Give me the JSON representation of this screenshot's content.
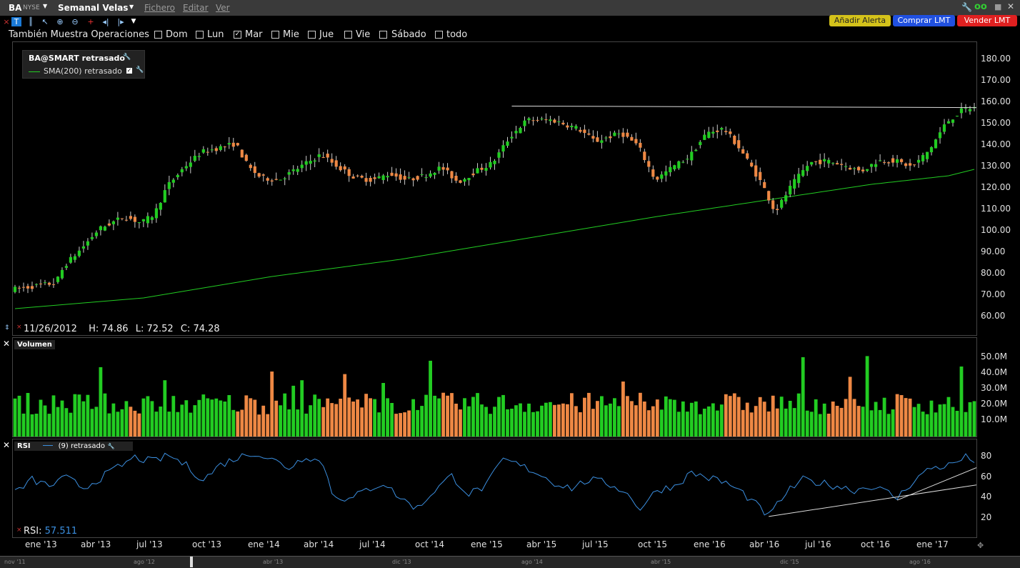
{
  "window": {
    "symbol": "BA",
    "exchange": "NYSE",
    "timeframe": "Semanal Velas",
    "menu": [
      "Fichero",
      "Editar",
      "Ver"
    ]
  },
  "buttons": {
    "alert": "Añadir Alerta",
    "buy": "Comprar LMT",
    "sell": "Vender LMT"
  },
  "options": {
    "label": "También Muestra Operaciones",
    "days": [
      {
        "label": "Dom",
        "checked": false
      },
      {
        "label": "Lun",
        "checked": false
      },
      {
        "label": "Mar",
        "checked": true
      },
      {
        "label": "Mie",
        "checked": false
      },
      {
        "label": "Jue",
        "checked": false
      },
      {
        "label": "Vie",
        "checked": false
      },
      {
        "label": "Sábado",
        "checked": false
      },
      {
        "label": "todo",
        "checked": false
      }
    ]
  },
  "price_panel": {
    "legend_title": "BA@SMART retrasado",
    "legend_sma": "SMA(200) retrasado",
    "info_date": "11/26/2012",
    "info_h": "H: 74.86",
    "info_l": "L: 72.52",
    "info_c": "C: 74.28",
    "y_ticks": [
      "180.00",
      "170.00",
      "160.00",
      "150.00",
      "140.00",
      "130.00",
      "120.00",
      "110.00",
      "100.00",
      "90.00",
      "80.00",
      "70.00",
      "60.00"
    ]
  },
  "volume_panel": {
    "title": "Volumen",
    "y_ticks": [
      "50.0M",
      "40.0M",
      "30.0M",
      "20.0M",
      "10.0M"
    ]
  },
  "rsi_panel": {
    "title": "RSI",
    "legend": "(9) retrasado",
    "readout_label": "RSI:",
    "readout_value": "57.511",
    "y_ticks": [
      "80",
      "60",
      "40",
      "20"
    ]
  },
  "x_ticks": [
    "ene '13",
    "abr '13",
    "jul '13",
    "oct '13",
    "ene '14",
    "abr '14",
    "jul '14",
    "oct '14",
    "ene '15",
    "abr '15",
    "jul '15",
    "oct '15",
    "ene '16",
    "abr '16",
    "jul '16",
    "oct '16",
    "ene '17"
  ],
  "overview_ticks": [
    "nov '11",
    "ago '12",
    "abr '13",
    "dic '13",
    "ago '14",
    "abr '15",
    "dic '15",
    "ago '16"
  ],
  "colors": {
    "up": "#22cc22",
    "down": "#ee8844",
    "sma": "#22cc22",
    "rsi": "#3b8fe0",
    "alert_btn": "#d4c21a",
    "buy_btn": "#2050e0",
    "sell_btn": "#e02020"
  },
  "chart_data": {
    "type": "candlestick",
    "weeks_shown": 225,
    "price_ylim": [
      55,
      185
    ],
    "price_knots": [
      [
        0,
        73
      ],
      [
        10,
        76
      ],
      [
        12,
        84
      ],
      [
        16,
        92
      ],
      [
        20,
        101
      ],
      [
        26,
        107
      ],
      [
        30,
        104
      ],
      [
        33,
        108
      ],
      [
        36,
        121
      ],
      [
        40,
        130
      ],
      [
        44,
        137
      ],
      [
        48,
        139
      ],
      [
        52,
        141
      ],
      [
        55,
        130
      ],
      [
        58,
        125
      ],
      [
        62,
        124
      ],
      [
        67,
        130
      ],
      [
        72,
        136
      ],
      [
        76,
        130
      ],
      [
        80,
        125
      ],
      [
        84,
        124
      ],
      [
        88,
        127
      ],
      [
        92,
        124
      ],
      [
        96,
        126
      ],
      [
        100,
        130
      ],
      [
        104,
        123
      ],
      [
        108,
        128
      ],
      [
        112,
        132
      ],
      [
        116,
        144
      ],
      [
        120,
        152
      ],
      [
        126,
        152
      ],
      [
        132,
        148
      ],
      [
        136,
        142
      ],
      [
        142,
        146
      ],
      [
        146,
        140
      ],
      [
        150,
        124
      ],
      [
        154,
        130
      ],
      [
        158,
        135
      ],
      [
        162,
        146
      ],
      [
        166,
        148
      ],
      [
        170,
        138
      ],
      [
        175,
        122
      ],
      [
        178,
        109
      ],
      [
        182,
        122
      ],
      [
        186,
        132
      ],
      [
        190,
        133
      ],
      [
        194,
        131
      ],
      [
        198,
        128
      ],
      [
        202,
        133
      ],
      [
        206,
        133
      ],
      [
        210,
        130
      ],
      [
        214,
        138
      ],
      [
        218,
        151
      ],
      [
        222,
        157
      ],
      [
        225,
        158
      ],
      [
        227,
        168
      ],
      [
        229,
        175
      ],
      [
        232,
        180
      ]
    ],
    "sma_points": [
      [
        0,
        64
      ],
      [
        30,
        69
      ],
      [
        60,
        79
      ],
      [
        90,
        87
      ],
      [
        120,
        97
      ],
      [
        150,
        107
      ],
      [
        180,
        116
      ],
      [
        200,
        122
      ],
      [
        218,
        126
      ],
      [
        232,
        133
      ]
    ],
    "volume_ylim": [
      0,
      60
    ],
    "rsi_ylim": [
      5,
      95
    ],
    "rsi_knots": [
      [
        0,
        45
      ],
      [
        4,
        58
      ],
      [
        8,
        52
      ],
      [
        12,
        60
      ],
      [
        16,
        50
      ],
      [
        20,
        60
      ],
      [
        24,
        70
      ],
      [
        28,
        80
      ],
      [
        32,
        76
      ],
      [
        36,
        82
      ],
      [
        40,
        72
      ],
      [
        44,
        58
      ],
      [
        48,
        73
      ],
      [
        52,
        80
      ],
      [
        56,
        85
      ],
      [
        60,
        78
      ],
      [
        64,
        70
      ],
      [
        68,
        82
      ],
      [
        72,
        74
      ],
      [
        74,
        45
      ],
      [
        78,
        38
      ],
      [
        82,
        48
      ],
      [
        86,
        55
      ],
      [
        90,
        40
      ],
      [
        94,
        30
      ],
      [
        98,
        48
      ],
      [
        102,
        62
      ],
      [
        106,
        44
      ],
      [
        110,
        52
      ],
      [
        114,
        78
      ],
      [
        118,
        72
      ],
      [
        122,
        65
      ],
      [
        126,
        55
      ],
      [
        130,
        50
      ],
      [
        134,
        58
      ],
      [
        138,
        55
      ],
      [
        142,
        48
      ],
      [
        146,
        30
      ],
      [
        150,
        48
      ],
      [
        154,
        52
      ],
      [
        158,
        65
      ],
      [
        162,
        60
      ],
      [
        166,
        55
      ],
      [
        170,
        45
      ],
      [
        174,
        30
      ],
      [
        176,
        22
      ],
      [
        180,
        45
      ],
      [
        184,
        58
      ],
      [
        188,
        55
      ],
      [
        192,
        52
      ],
      [
        196,
        48
      ],
      [
        200,
        52
      ],
      [
        204,
        45
      ],
      [
        206,
        40
      ],
      [
        210,
        58
      ],
      [
        214,
        70
      ],
      [
        218,
        72
      ],
      [
        222,
        80
      ],
      [
        226,
        75
      ],
      [
        230,
        80
      ]
    ],
    "resistance_line": [
      [
        116,
        158.5
      ],
      [
        232,
        157.8
      ]
    ],
    "rsi_trend1": [
      [
        176,
        22
      ],
      [
        232,
        53
      ]
    ],
    "rsi_trend2": [
      [
        206,
        38
      ],
      [
        230,
        70
      ]
    ]
  }
}
